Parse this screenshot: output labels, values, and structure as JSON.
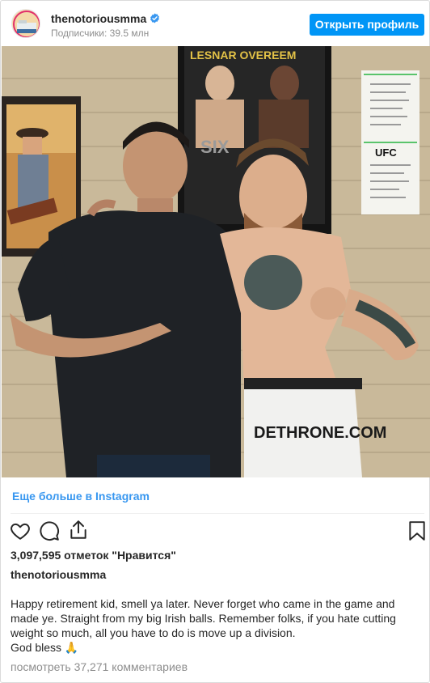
{
  "header": {
    "username": "thenotoriousmma",
    "followers": "Подписчики: 39.5 млн",
    "open_profile_label": "Открыть профиль"
  },
  "photo": {
    "poster_text_top": "LESNAR  OVEREEM",
    "poster_text_mid": "SIX",
    "ufc_logo": "UFC",
    "shorts_text": "DETHRONE.COM"
  },
  "more_link": "Еще больше в Instagram",
  "actions": {
    "like_icon": "heart-icon",
    "comment_icon": "comment-icon",
    "share_icon": "share-icon",
    "save_icon": "bookmark-icon"
  },
  "likes": "3,097,595 отметок \"Нравится\"",
  "caption_user": "thenotoriousmma",
  "caption_text": "Happy retirement kid, smell ya later. Never forget who came in the game and made ye. Straight from my big Irish balls. Remember folks, if you hate cutting weight so much, all you have to do is move up a division.\nGod bless 🙏",
  "comments_link": "посмотреть 37,271 комментариев",
  "colors": {
    "accent": "#0095f6",
    "link": "#3897f0",
    "muted": "#8e8e8e",
    "text": "#262626"
  }
}
